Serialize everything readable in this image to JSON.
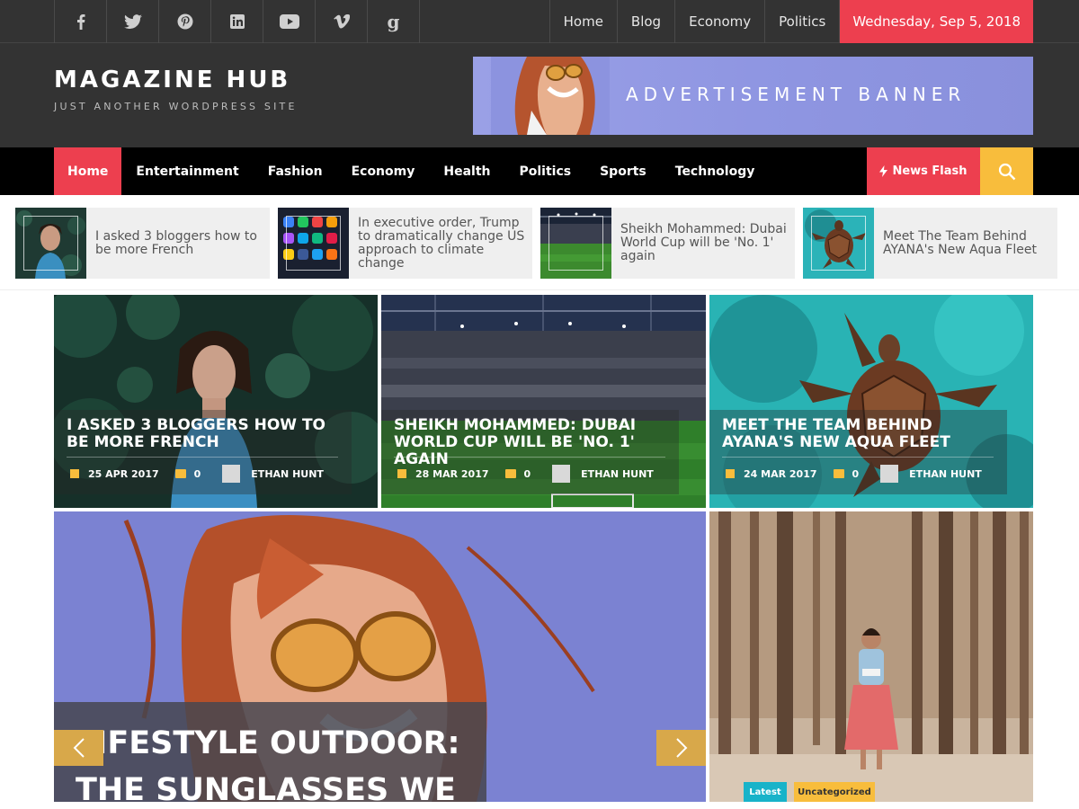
{
  "topbar": {
    "social": [
      {
        "icon": "facebook-icon",
        "glyph": "f"
      },
      {
        "icon": "twitter-icon",
        "glyph": "🐦"
      },
      {
        "icon": "pinterest-icon",
        "glyph": "℗"
      },
      {
        "icon": "linkedin-icon",
        "glyph": "in"
      },
      {
        "icon": "youtube-icon",
        "glyph": "▶"
      },
      {
        "icon": "vimeo-icon",
        "glyph": "v"
      },
      {
        "icon": "google-icon",
        "glyph": "g"
      }
    ],
    "links": [
      "Home",
      "Blog",
      "Economy",
      "Politics"
    ],
    "date": "Wednesday, Sep 5, 2018"
  },
  "header": {
    "title": "MAGAZINE HUB",
    "tagline": "JUST ANOTHER WORDPRESS SITE",
    "banner_text": "ADVERTISEMENT BANNER"
  },
  "nav": {
    "items": [
      "Home",
      "Entertainment",
      "Fashion",
      "Economy",
      "Health",
      "Politics",
      "Sports",
      "Technology"
    ],
    "active": "Home",
    "news_flash": "News Flash",
    "accent": "#ed3f4f",
    "search_color": "#f8bd3c"
  },
  "ticker": [
    {
      "title": "I asked 3 bloggers how to be more French"
    },
    {
      "title": "In executive order, Trump to dramatically change US approach to climate change"
    },
    {
      "title": "Sheikh Mohammed: Dubai World Cup will be 'No. 1' again"
    },
    {
      "title": "Meet The Team Behind AYANA's New Aqua Fleet"
    }
  ],
  "featured": [
    {
      "title": "I ASKED 3 BLOGGERS HOW TO BE MORE FRENCH",
      "date": "25 APR 2017",
      "comments": "0",
      "author": "ETHAN HUNT"
    },
    {
      "title": "SHEIKH MOHAMMED: DUBAI WORLD CUP WILL BE 'NO. 1' AGAIN",
      "date": "28 MAR 2017",
      "comments": "0",
      "author": "ETHAN HUNT"
    },
    {
      "title": "MEET THE TEAM BEHIND AYANA'S NEW AQUA FLEET",
      "date": "24 MAR 2017",
      "comments": "0",
      "author": "ETHAN HUNT"
    }
  ],
  "slider": {
    "title": "LIFESTYLE OUTDOOR: THE SUNGLASSES WE"
  },
  "side_card": {
    "tags": [
      "Latest",
      "Uncategorized"
    ]
  }
}
